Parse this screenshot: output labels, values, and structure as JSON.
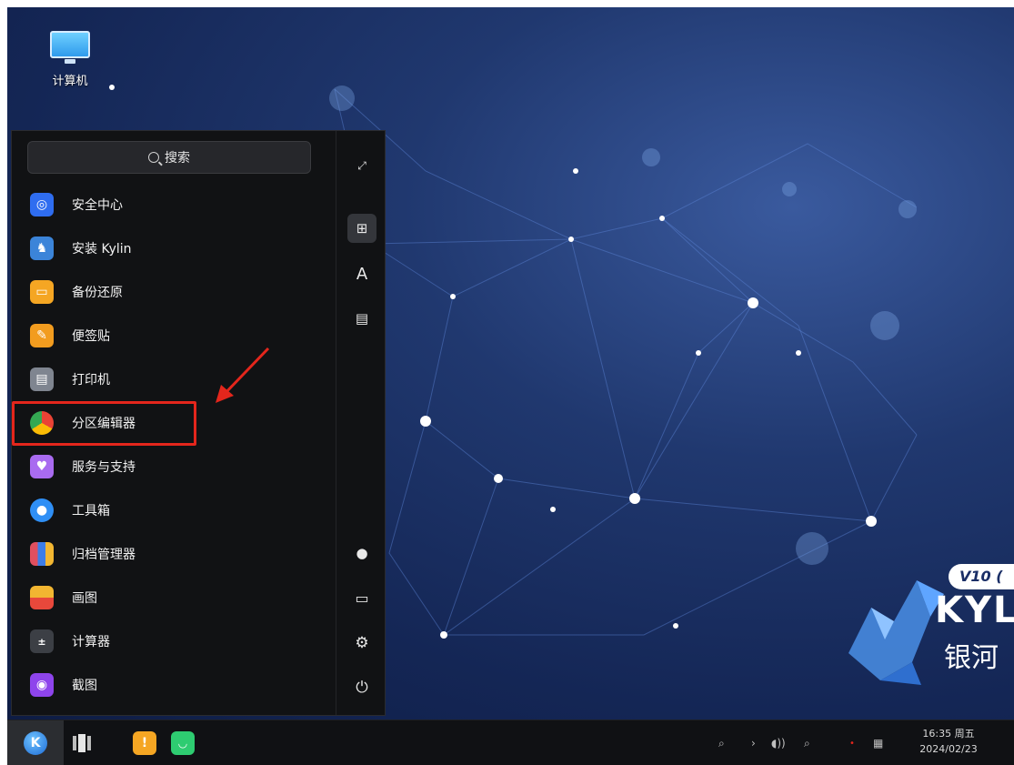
{
  "desktop": {
    "computer_icon_label": "计算机",
    "brand": {
      "badge": "V10 (",
      "name": "KYL",
      "subtitle": "银河",
      "logo_icon": "kylin-logo-icon"
    }
  },
  "start_menu": {
    "search_placeholder": "搜索",
    "apps": [
      {
        "label": "安全中心",
        "icon": "security-center-icon",
        "color": "#2f6df0"
      },
      {
        "label": "安装 Kylin",
        "icon": "install-kylin-icon",
        "color": "#3b84d9"
      },
      {
        "label": "备份还原",
        "icon": "backup-restore-icon",
        "color": "#f5a623"
      },
      {
        "label": "便签贴",
        "icon": "sticky-note-icon",
        "color": "#f29c1f"
      },
      {
        "label": "打印机",
        "icon": "printer-icon",
        "color": "#7f8590"
      },
      {
        "label": "分区编辑器",
        "icon": "partition-editor-icon",
        "color": "#34a853"
      },
      {
        "label": "服务与支持",
        "icon": "service-support-icon",
        "color": "#a96bf0"
      },
      {
        "label": "工具箱",
        "icon": "toolbox-icon",
        "color": "#2f8ff5"
      },
      {
        "label": "归档管理器",
        "icon": "archive-manager-icon",
        "color": "#e04f5f"
      },
      {
        "label": "画图",
        "icon": "paint-icon",
        "color": "#e8483b"
      },
      {
        "label": "计算器",
        "icon": "calculator-icon",
        "color": "#3c3f45"
      },
      {
        "label": "截图",
        "icon": "screenshot-icon",
        "color": "#8e44ec"
      }
    ],
    "side": {
      "expand": "expand-icon",
      "grid": "grid-view-icon",
      "letter_sort": "A",
      "category": "category-icon",
      "user": "user-icon",
      "computer": "computer-icon",
      "settings": "settings-icon",
      "power": "power-icon"
    }
  },
  "taskbar": {
    "start_label": "K",
    "time": "16:35 周五",
    "date": "2024/02/23"
  }
}
